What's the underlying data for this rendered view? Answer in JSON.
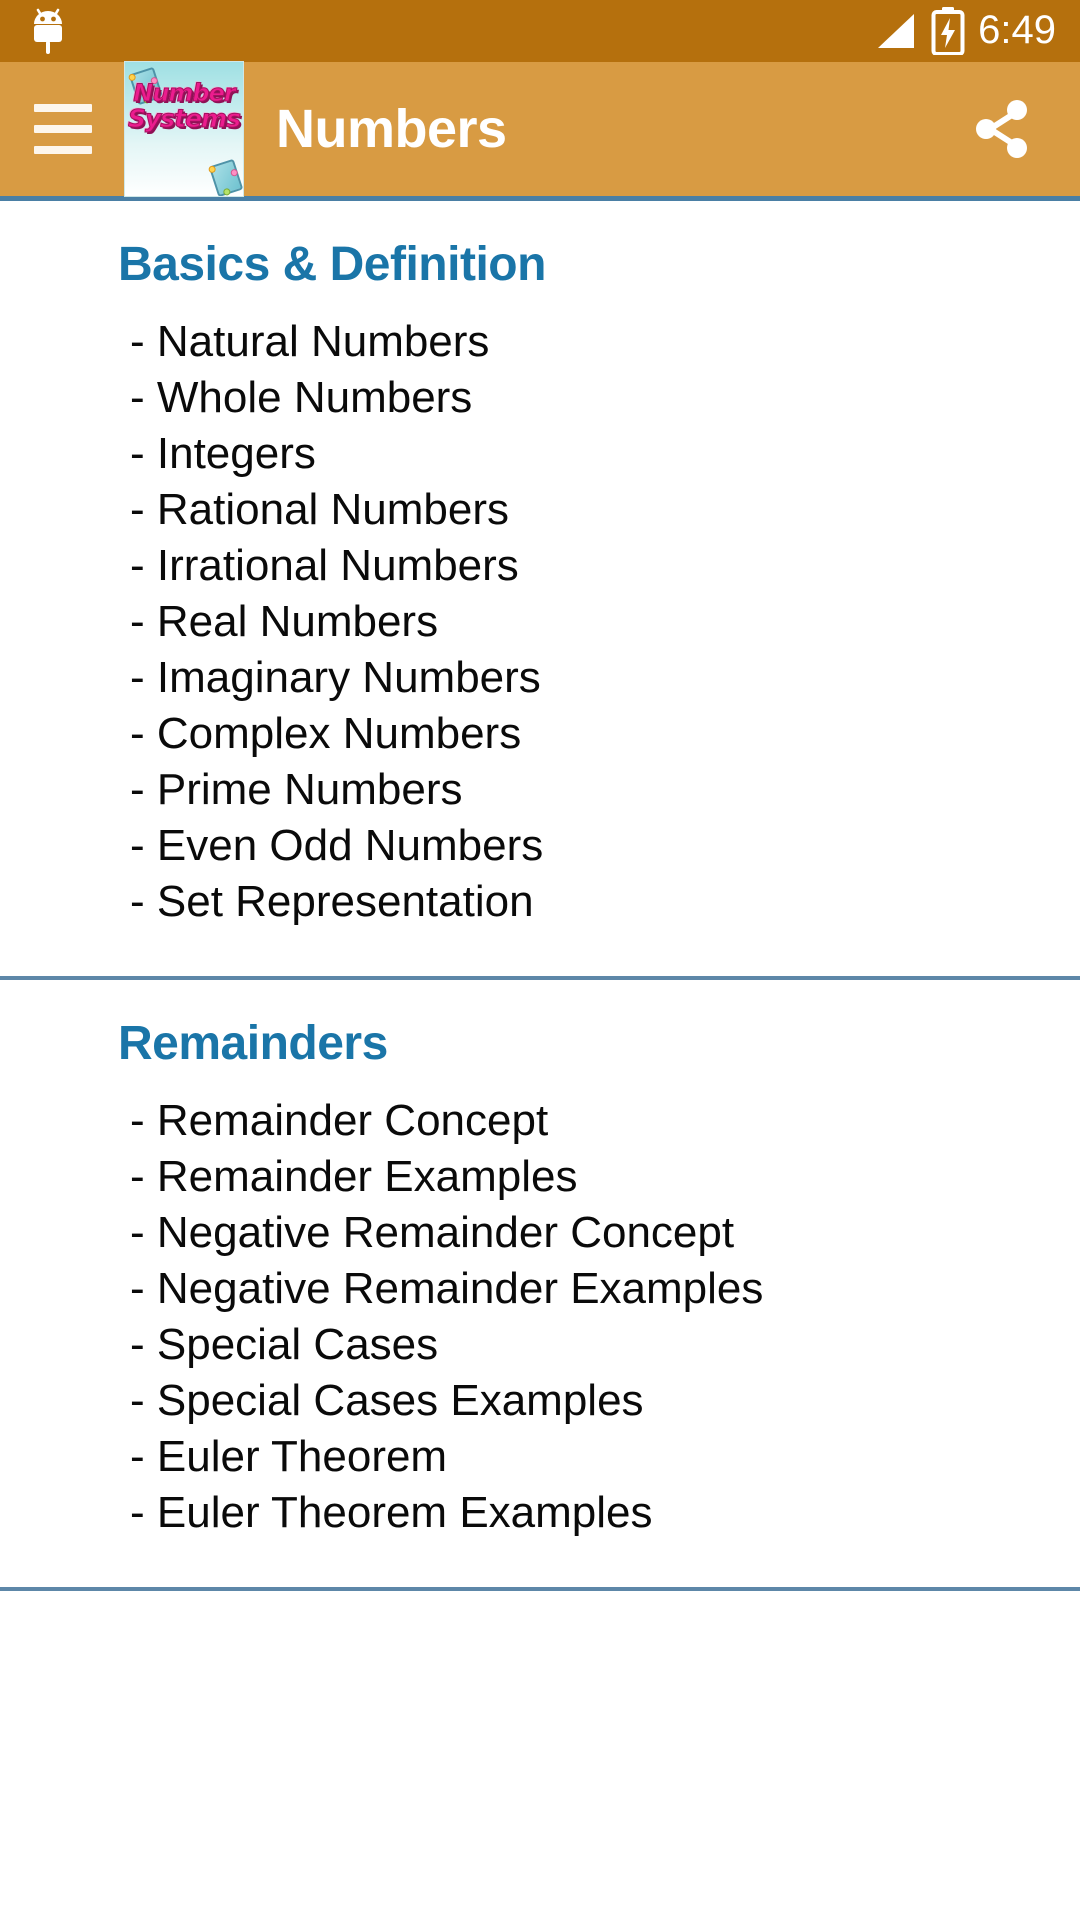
{
  "status_bar": {
    "notification_icon": "android-robot-icon",
    "signal_icon": "signal-strength-icon",
    "battery_icon": "battery-charging-icon",
    "time": "6:49",
    "background_color": "#b5700d",
    "text_color": "#ffffff"
  },
  "app_bar": {
    "menu_icon": "hamburger-menu-icon",
    "app_icon": {
      "name": "number-systems-app-icon",
      "line1": "Number",
      "line2": "Systems"
    },
    "title": "Numbers",
    "share_icon": "share-icon",
    "background_color": "#d89b43",
    "title_color": "#ffffff",
    "underline_color": "#4a7fa5"
  },
  "accent_colors": {
    "section_heading": "#1a75a8",
    "divider": "#5d87a8",
    "item_text": "#0a0a0a"
  },
  "sections": [
    {
      "title": "Basics & Definition",
      "items": [
        "- Natural Numbers",
        "- Whole Numbers",
        "- Integers",
        "- Rational Numbers",
        "- Irrational Numbers",
        "- Real Numbers",
        "- Imaginary Numbers",
        "- Complex Numbers",
        "- Prime Numbers",
        "- Even Odd Numbers",
        "- Set Representation"
      ]
    },
    {
      "title": "Remainders",
      "items": [
        "- Remainder Concept",
        "- Remainder Examples",
        "- Negative Remainder Concept",
        "- Negative Remainder Examples",
        "- Special Cases",
        "- Special Cases Examples",
        "- Euler Theorem",
        "- Euler Theorem Examples"
      ]
    }
  ]
}
